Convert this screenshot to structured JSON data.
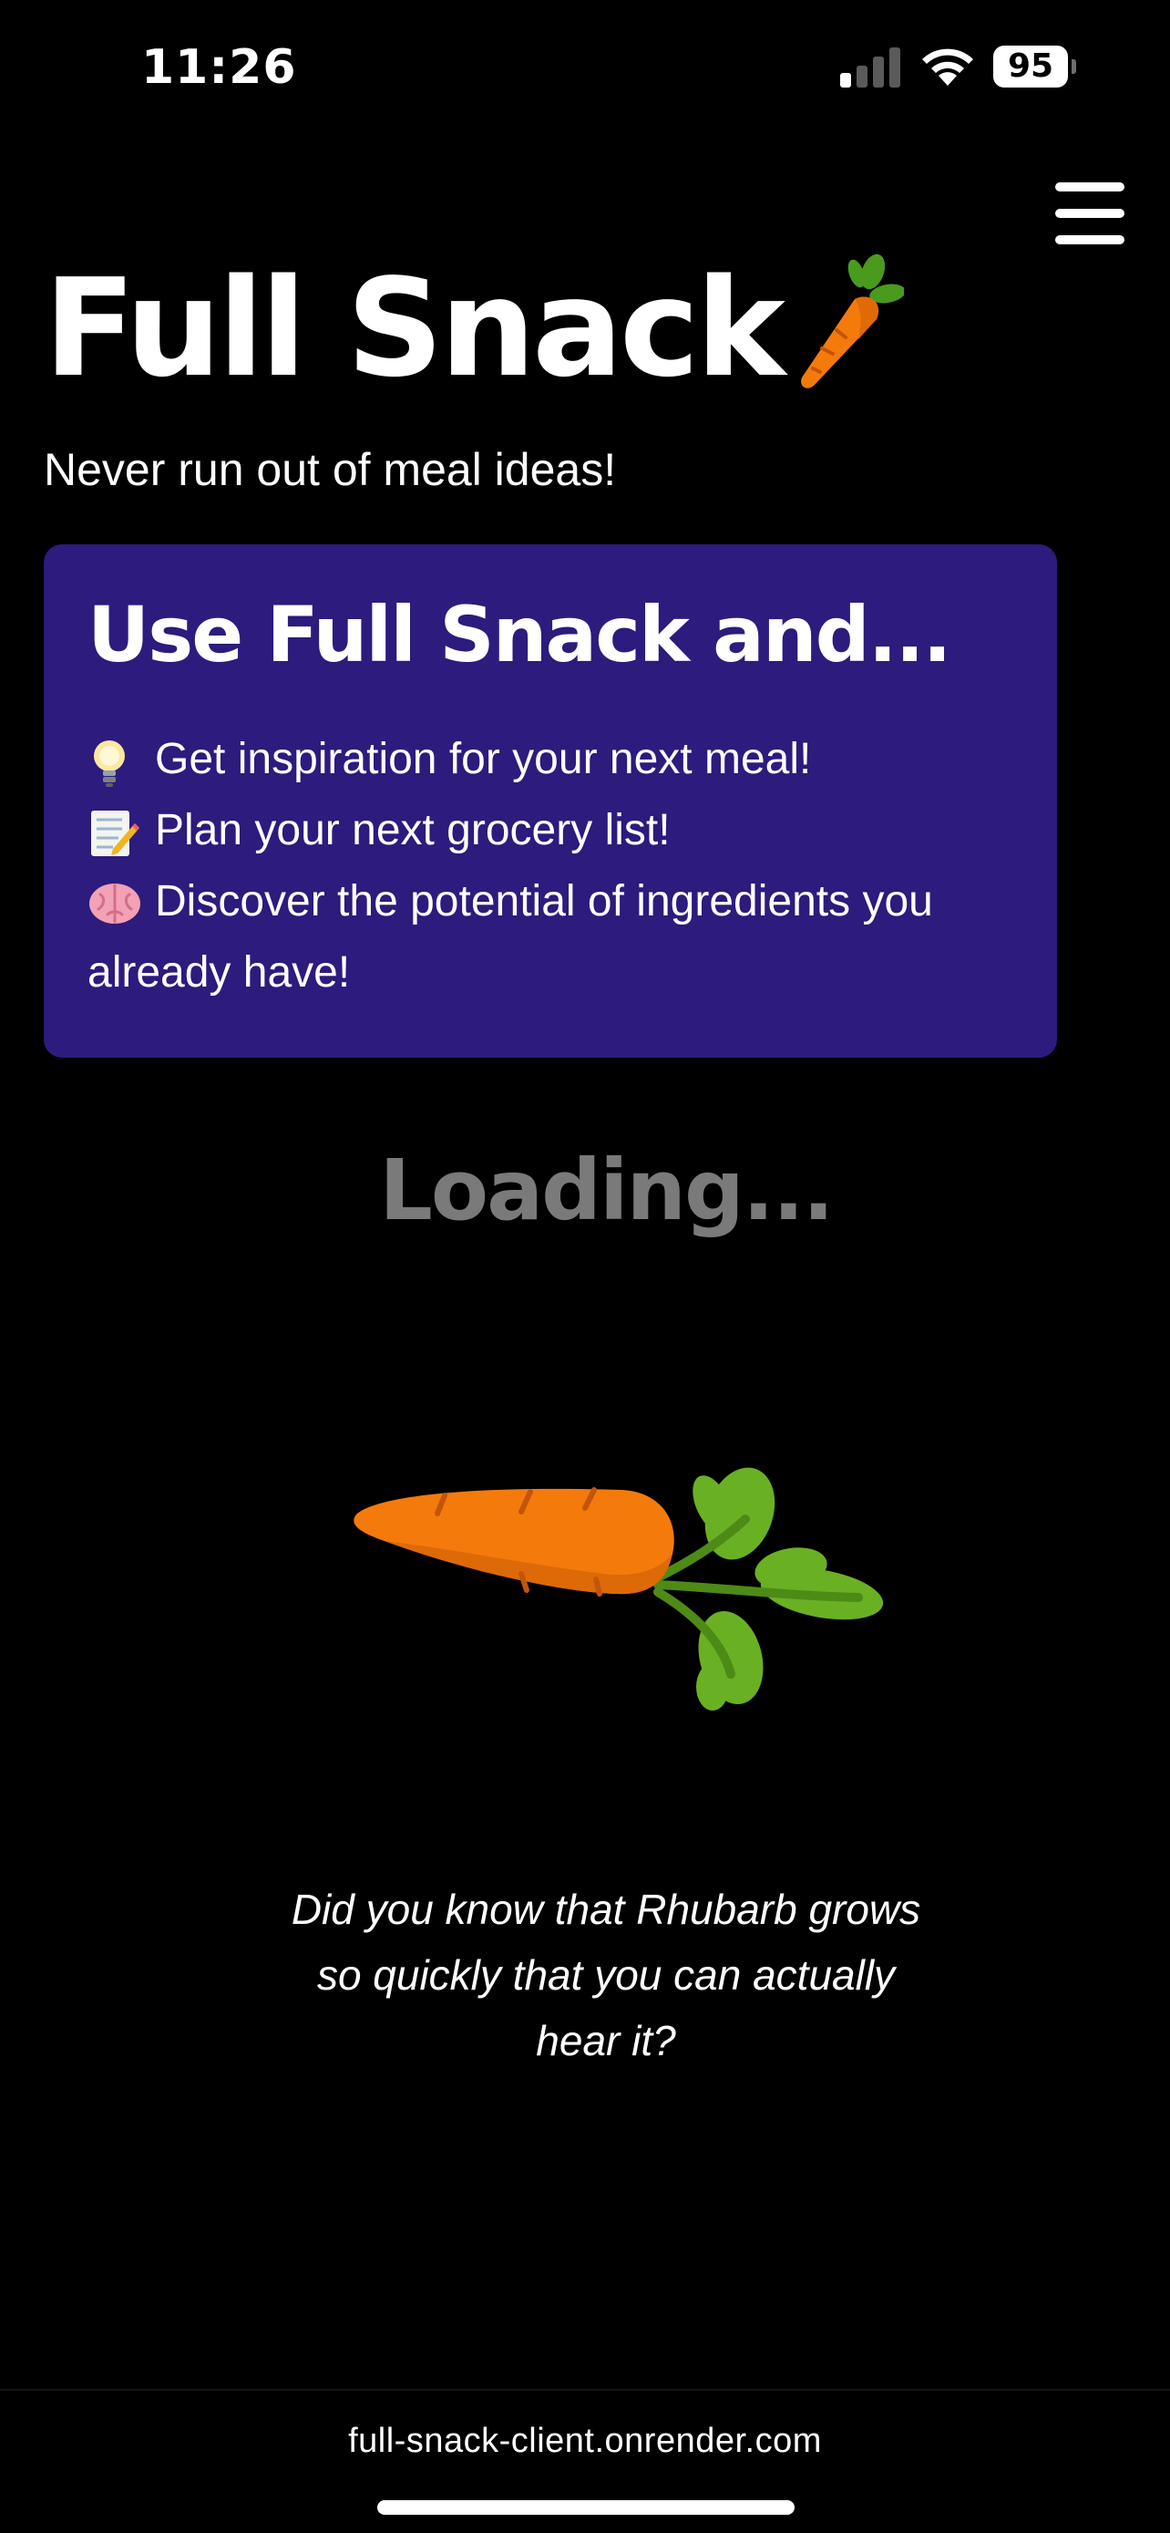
{
  "status_bar": {
    "time": "11:26",
    "battery_level": "95",
    "signal_bars_active": 1,
    "signal_bars_total": 4
  },
  "header": {
    "title": "Full Snack",
    "title_icon": "carrot-icon",
    "tagline": "Never run out of meal ideas!",
    "menu_icon": "hamburger-menu-icon"
  },
  "feature_card": {
    "heading": "Use Full Snack and...",
    "background_color": "#2d1b7d",
    "items": [
      {
        "icon": "lightbulb-icon",
        "text": "Get inspiration for your next meal!"
      },
      {
        "icon": "memo-icon",
        "text": "Plan your next grocery list!"
      },
      {
        "icon": "brain-icon",
        "text_line1": "Discover the potential of ingredients you",
        "text_line2": "already have!"
      }
    ]
  },
  "loading": {
    "label": "Loading...",
    "icon": "carrot-icon"
  },
  "fun_fact": {
    "line1": "Did you know that Rhubarb grows",
    "line2": "so quickly that you can actually",
    "line3": "hear it?"
  },
  "browser": {
    "url": "full-snack-client.onrender.com"
  },
  "colors": {
    "background": "#000000",
    "card": "#2d1b7d",
    "carrot_orange": "#f57a0c",
    "carrot_leaf": "#6ab023",
    "loading_gray": "#7a7a7a"
  }
}
